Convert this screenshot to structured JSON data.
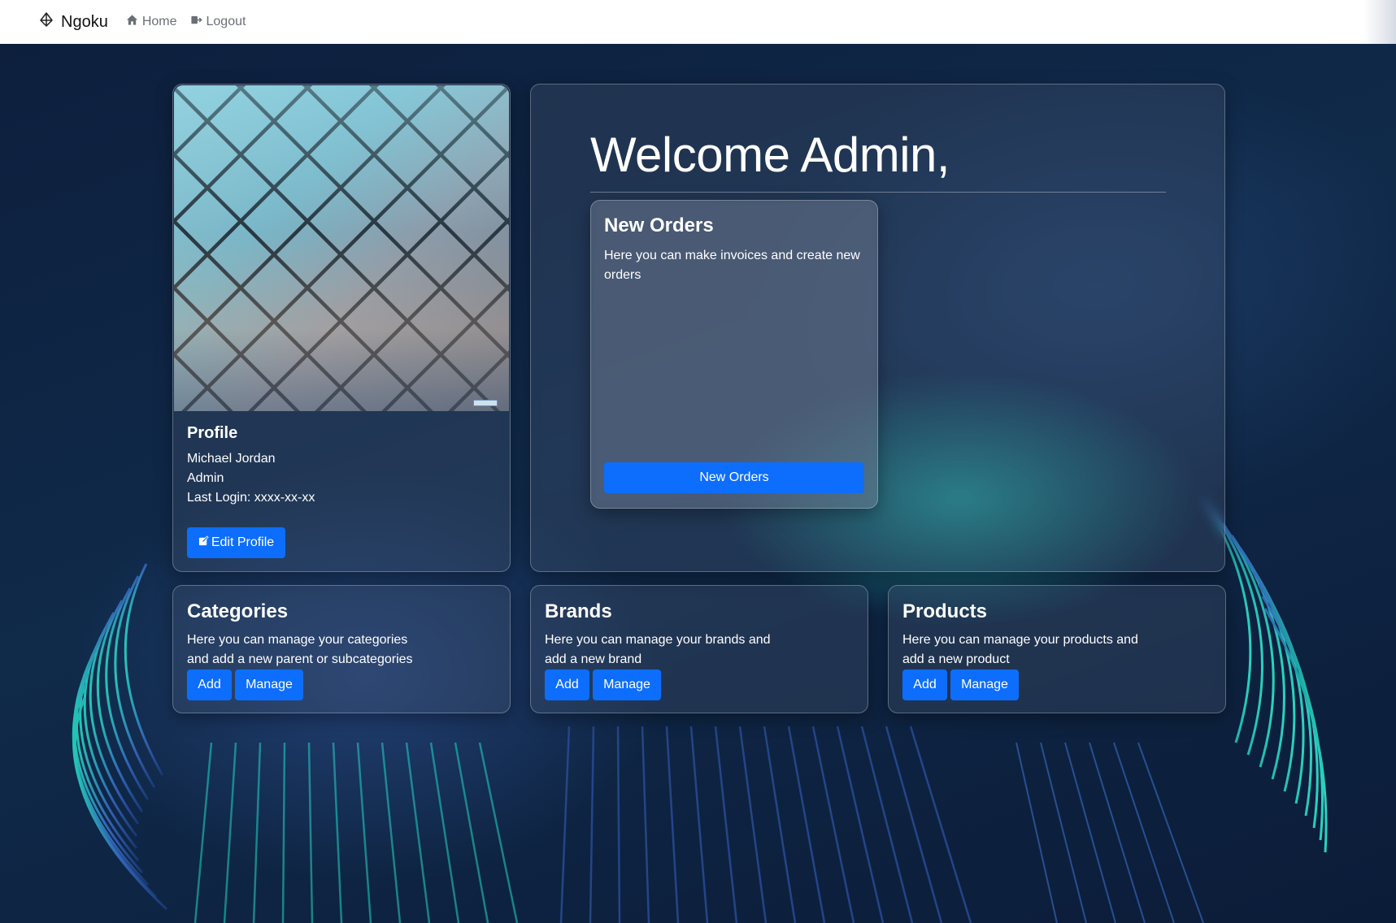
{
  "nav": {
    "brand": "Ngoku",
    "brand_icon": "diamond-icon",
    "home": "Home",
    "home_icon": "house-icon",
    "logout": "Logout",
    "logout_icon": "logout-icon"
  },
  "profile": {
    "title": "Profile",
    "name": "Michael Jordan",
    "role": "Admin",
    "last_login": "Last Login: xxxx-xx-xx",
    "edit_label": "Edit Profile",
    "edit_icon": "pencil-square-icon"
  },
  "welcome": {
    "title": "Welcome Admin,",
    "orders": {
      "title": "New Orders",
      "description": "Here you can make invoices and create new orders",
      "button": "New Orders"
    }
  },
  "cards": [
    {
      "title": "Categories",
      "description": "Here you can manage your categories and add a new parent or subcategories",
      "add": "Add",
      "manage": "Manage"
    },
    {
      "title": "Brands",
      "description": "Here you can manage your brands and add a new brand",
      "add": "Add",
      "manage": "Manage"
    },
    {
      "title": "Products",
      "description": "Here you can manage your products and add a new product",
      "add": "Add",
      "manage": "Manage"
    }
  ],
  "colors": {
    "primary": "#0d6efd",
    "navbar_bg": "#ffffff",
    "page_bg": "#0b1a33",
    "accent_teal": "#28dcc8"
  }
}
